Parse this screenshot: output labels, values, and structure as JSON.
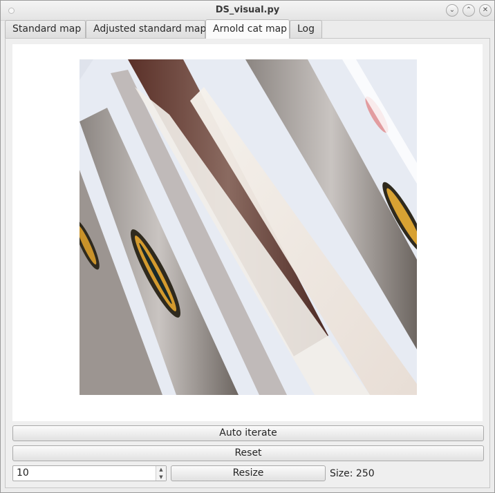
{
  "window": {
    "title": "DS_visual.py",
    "controls": [
      "chevron-down-icon",
      "chevron-up-icon",
      "close-icon"
    ]
  },
  "tabs": [
    {
      "label": "Standard map",
      "active": false
    },
    {
      "label": "Adjusted standard map",
      "active": false
    },
    {
      "label": "Arnold cat map",
      "active": true
    },
    {
      "label": "Log",
      "active": false
    }
  ],
  "controls": {
    "auto_iterate_label": "Auto iterate",
    "reset_label": "Reset",
    "iterations_value": "10",
    "resize_label": "Resize",
    "size_text": "Size: 250"
  }
}
